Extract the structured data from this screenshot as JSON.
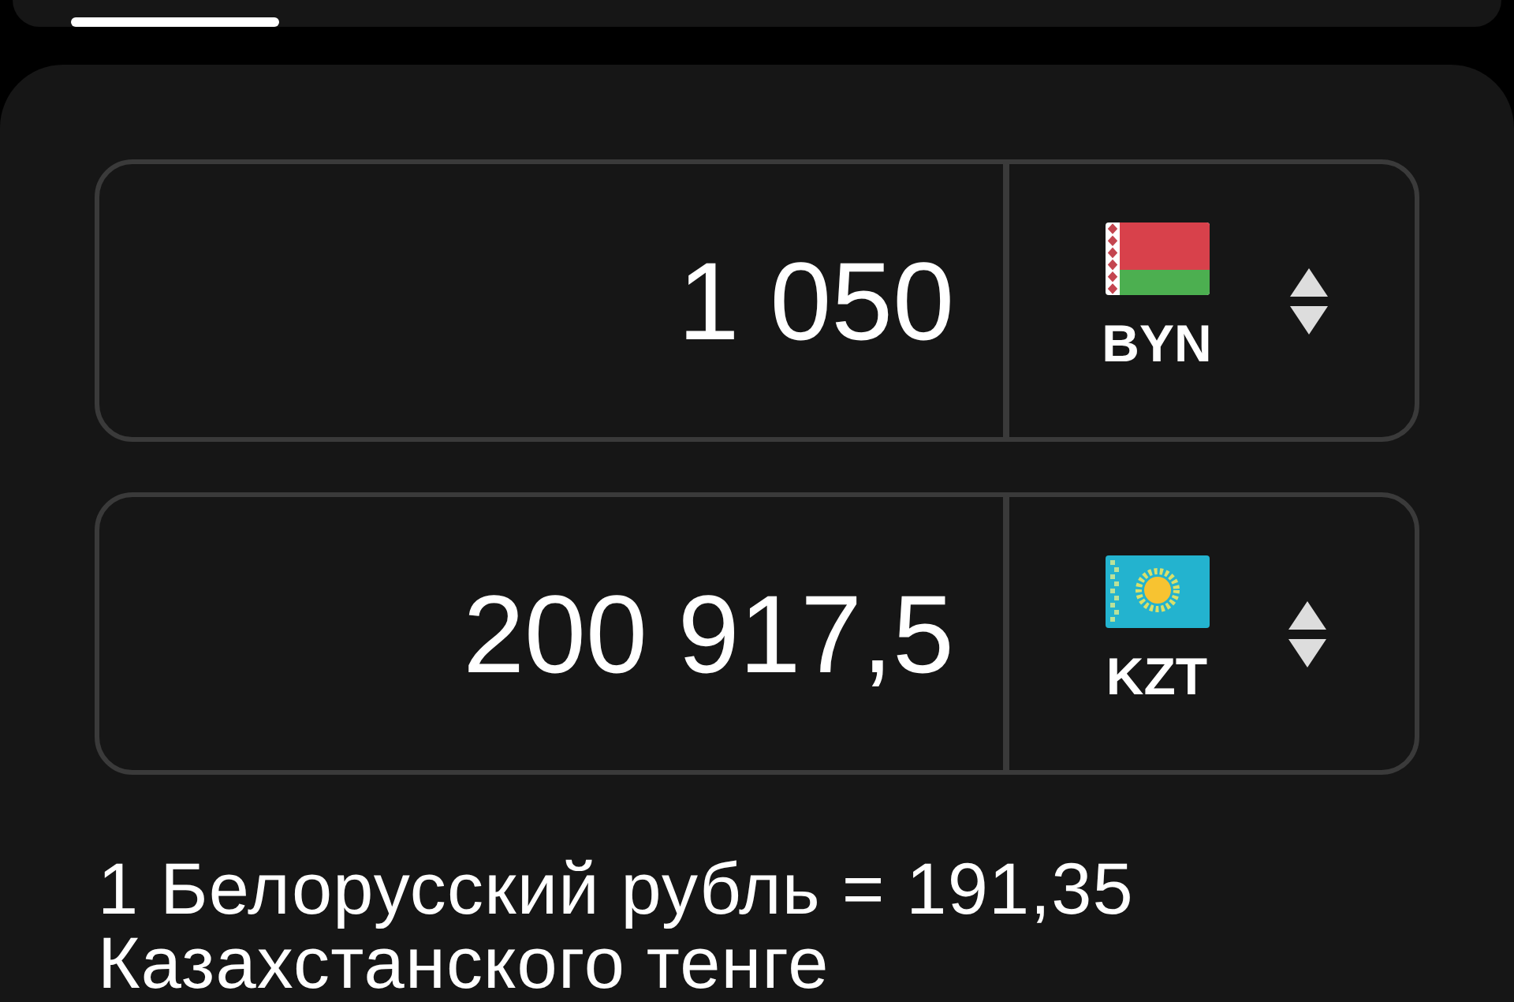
{
  "converter": {
    "rows": [
      {
        "amount": "1 050",
        "currency_code": "BYN",
        "kind": "belarus"
      },
      {
        "amount": "200 917,5",
        "currency_code": "KZT",
        "kind": "kazakhstan"
      }
    ]
  },
  "rate": "1 Белорусский рубль = 191,35 Казахстанского тенге"
}
